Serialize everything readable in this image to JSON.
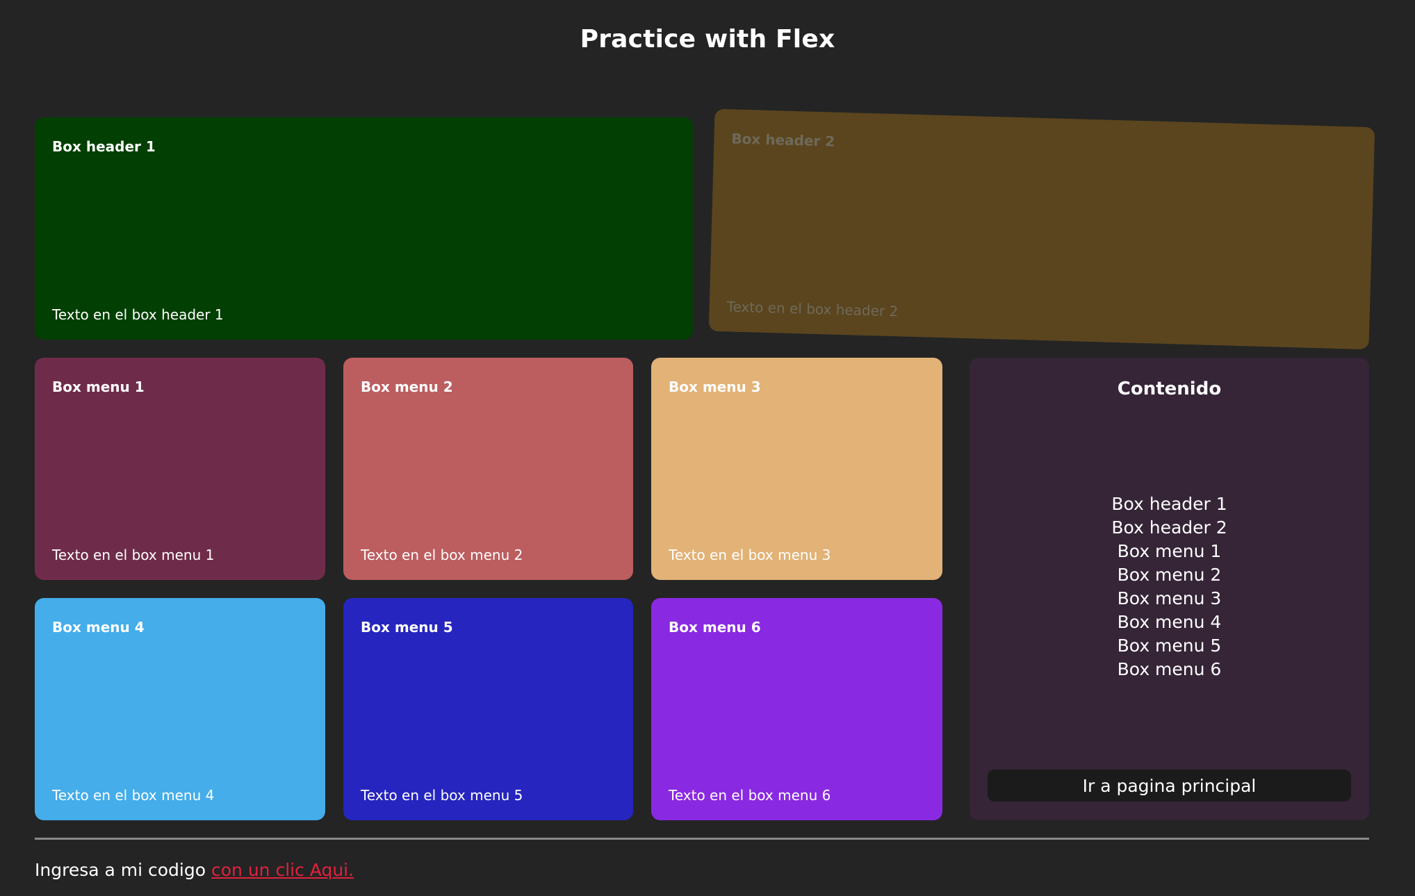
{
  "page": {
    "title": "Practice with Flex"
  },
  "boxes": [
    {
      "title": "Box header 1",
      "text": "Texto en el box header 1",
      "color": "#023F02"
    },
    {
      "title": "Box header 2",
      "text": "Texto en el box header 2",
      "color": "#5B451E"
    },
    {
      "title": "Box menu 1",
      "text": "Texto en el box menu 1",
      "color": "#6F2C4A"
    },
    {
      "title": "Box menu 2",
      "text": "Texto en el box menu 2",
      "color": "#BC5D5F"
    },
    {
      "title": "Box menu 3",
      "text": "Texto en el box menu 3",
      "color": "#E2B276"
    },
    {
      "title": "Box menu 4",
      "text": "Texto en el box menu 4",
      "color": "#44ADEA"
    },
    {
      "title": "Box menu 5",
      "text": "Texto en el box menu 5",
      "color": "#2625BF"
    },
    {
      "title": "Box menu 6",
      "text": "Texto en el box menu 6",
      "color": "#8A29E2"
    }
  ],
  "contenido": {
    "title": "Contenido",
    "items": [
      "Box header 1",
      "Box header 2",
      "Box menu 1",
      "Box menu 2",
      "Box menu 3",
      "Box menu 4",
      "Box menu 5",
      "Box menu 6"
    ],
    "button_label": "Ir a pagina principal",
    "panel_color": "#352537"
  },
  "footer": {
    "prefix": "Ingresa a mi codigo",
    "link_text": "con un clic Aqui.",
    "link_color": "#E0223D"
  },
  "colors": {
    "background": "#242424",
    "button_background": "#1B1B1B"
  }
}
